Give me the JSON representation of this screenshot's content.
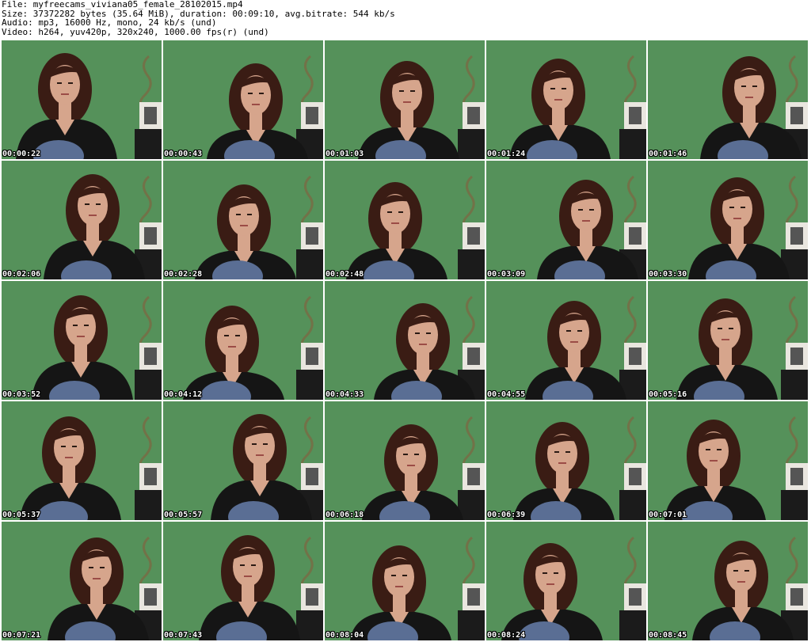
{
  "header": {
    "file_line": "File: myfreecams_viviana05_female_28102015.mp4",
    "size_line": "Size: 37372282 bytes (35.64 MiB), duration: 00:09:10, avg.bitrate: 544 kb/s",
    "audio_line": "Audio: mp3, 16000 Hz, mono, 24 kb/s (und)",
    "video_line": "Video: h264, yuv420p, 320x240, 1000.00 fps(r) (und)"
  },
  "colors": {
    "background": "#ffffff",
    "green_wall": "#55915a",
    "hair": "#3a1c14",
    "shirt": "#151515",
    "skin": "#d6a58c",
    "jeans": "#5a6e94"
  },
  "thumbnails": [
    {
      "timestamp": "00:00:22",
      "icon": "video-frame"
    },
    {
      "timestamp": "00:00:43",
      "icon": "video-frame"
    },
    {
      "timestamp": "00:01:03",
      "icon": "video-frame"
    },
    {
      "timestamp": "00:01:24",
      "icon": "video-frame"
    },
    {
      "timestamp": "00:01:46",
      "icon": "video-frame"
    },
    {
      "timestamp": "00:02:06",
      "icon": "video-frame"
    },
    {
      "timestamp": "00:02:28",
      "icon": "video-frame"
    },
    {
      "timestamp": "00:02:48",
      "icon": "video-frame"
    },
    {
      "timestamp": "00:03:09",
      "icon": "video-frame"
    },
    {
      "timestamp": "00:03:30",
      "icon": "video-frame"
    },
    {
      "timestamp": "00:03:52",
      "icon": "video-frame"
    },
    {
      "timestamp": "00:04:12",
      "icon": "video-frame"
    },
    {
      "timestamp": "00:04:33",
      "icon": "video-frame"
    },
    {
      "timestamp": "00:04:55",
      "icon": "video-frame"
    },
    {
      "timestamp": "00:05:16",
      "icon": "video-frame"
    },
    {
      "timestamp": "00:05:37",
      "icon": "video-frame"
    },
    {
      "timestamp": "00:05:57",
      "icon": "video-frame"
    },
    {
      "timestamp": "00:06:18",
      "icon": "video-frame"
    },
    {
      "timestamp": "00:06:39",
      "icon": "video-frame"
    },
    {
      "timestamp": "00:07:01",
      "icon": "video-frame"
    },
    {
      "timestamp": "00:07:21",
      "icon": "video-frame"
    },
    {
      "timestamp": "00:07:43",
      "icon": "video-frame"
    },
    {
      "timestamp": "00:08:04",
      "icon": "video-frame"
    },
    {
      "timestamp": "00:08:24",
      "icon": "video-frame"
    },
    {
      "timestamp": "00:08:45",
      "icon": "video-frame"
    }
  ]
}
